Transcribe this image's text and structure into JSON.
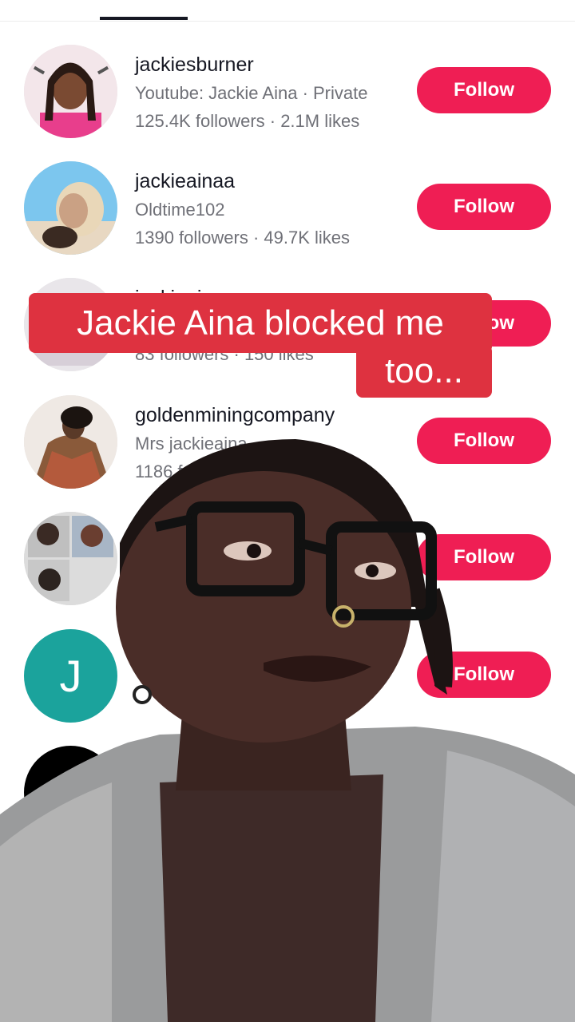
{
  "tabs": {
    "active_index": 1
  },
  "accounts": [
    {
      "username": "jackiesburner",
      "subtitle": "Youtube: Jackie Aina · Private",
      "stats": "125.4K followers · 2.1M likes",
      "follow_label": "Follow"
    },
    {
      "username": "jackieainaa",
      "subtitle": "Oldtime102",
      "stats": "1390 followers · 49.7K likes",
      "follow_label": "Follow"
    },
    {
      "username": "jackieaina",
      "subtitle": "",
      "stats": "83 followers · 150 likes",
      "follow_label": "Follow"
    },
    {
      "username": "goldenminingcompany",
      "subtitle": "Mrs jackieaina",
      "stats": "1186 followers",
      "follow_label": "Follow"
    },
    {
      "username": "",
      "subtitle": "",
      "stats": "",
      "follow_label": "Follow"
    },
    {
      "username": "",
      "subtitle": "",
      "stats": "",
      "follow_label": "Follow",
      "avatar_letter": "J"
    },
    {
      "username": "",
      "subtitle": "",
      "stats": ""
    }
  ],
  "caption": {
    "line1": "Jackie Aina blocked me",
    "line2": "too..."
  },
  "colors": {
    "follow": "#ef1e54",
    "caption_bg": "#de3240",
    "avatar_letter_bg": "#1ba39c"
  }
}
